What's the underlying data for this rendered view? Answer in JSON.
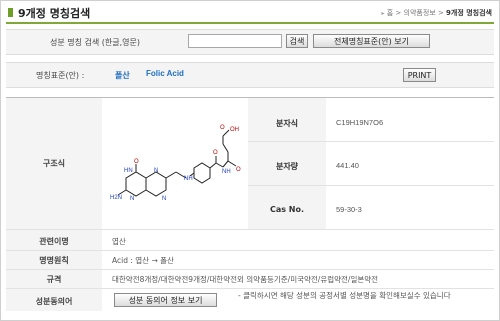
{
  "header": {
    "title": "9개정 명칭검색",
    "breadcrumb": {
      "home": "홈",
      "section": "의약품정보",
      "current": "9개정 명칭검색"
    }
  },
  "search": {
    "label": "성분 명칭 검색 (한글,영문)",
    "input_value": "",
    "search_button": "검색",
    "standard_button": "전체명칭표준(안) 보기"
  },
  "standard": {
    "label": "명칭표준(안) :",
    "name_ko": "폴산",
    "name_en": "Folic Acid",
    "print_button": "PRINT"
  },
  "info": {
    "structure_label": "구조식",
    "properties": [
      {
        "label": "분자식",
        "value": "C19H19N7O6"
      },
      {
        "label": "분자량",
        "value": "441.40"
      },
      {
        "label": "Cas No.",
        "value": "59-30-3"
      }
    ],
    "rows": [
      {
        "label": "관련이명",
        "value": "엽산"
      },
      {
        "label": "명명원칙",
        "value": "Acid : 엽산 → 폴산"
      },
      {
        "label": "규격",
        "value": "대한약전8개정/대한약전9개정/대한약전외 의약품등기준/미국약전/유럽약전/일본약전"
      }
    ],
    "consent": {
      "label": "성분동의어",
      "button": "성분 동의어 정보 보기",
      "note": "- 클릭하시면 해당 성분의 공정서별 성분명을 확인해보실수 있습니다"
    }
  },
  "colors": {
    "accent": "#7fa837",
    "link": "#1f6fc0"
  }
}
